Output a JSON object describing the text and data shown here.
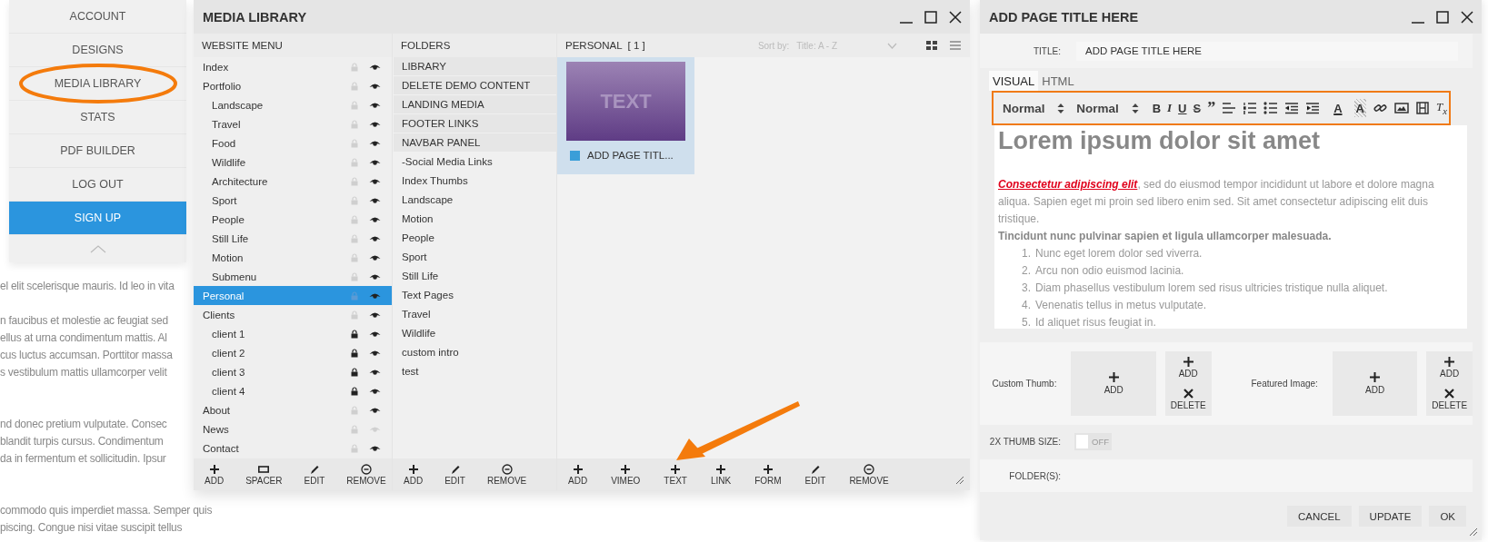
{
  "background_text": [
    [
      "el elit scelerisque mauris. Id leo in vita"
    ],
    [
      "n faucibus et molestie ac feugiat sed",
      "ellus at urna condimentum mattis. Al",
      "cus luctus accumsan. Porttitor massa",
      "s vestibulum mattis ullamcorper velit"
    ],
    [
      "nd donec pretium vulputate. Consec",
      "blandit turpis cursus. Condimentum",
      "da in fermentum et sollicitudin. Ipsur"
    ],
    [
      "commodo quis imperdiet massa. Semper quis",
      "piscing. Congue nisi vitae suscipit tellus"
    ]
  ],
  "account_menu": {
    "items": [
      {
        "label": "ACCOUNT",
        "kind": "item",
        "circled": false
      },
      {
        "label": "DESIGNS",
        "kind": "item",
        "circled": false
      },
      {
        "label": "MEDIA LIBRARY",
        "kind": "item",
        "circled": true
      },
      {
        "label": "STATS",
        "kind": "item",
        "circled": false
      },
      {
        "label": "PDF BUILDER",
        "kind": "item",
        "circled": false
      },
      {
        "label": "LOG OUT",
        "kind": "item",
        "circled": false
      },
      {
        "label": "SIGN UP",
        "kind": "cta",
        "circled": false
      }
    ]
  },
  "media_library": {
    "title": "MEDIA LIBRARY",
    "website_menu": {
      "heading": "WEBSITE MENU",
      "items": [
        {
          "label": "Index",
          "selected": false,
          "locked": false,
          "visible": true
        },
        {
          "label": "Portfolio",
          "selected": false,
          "locked": false,
          "visible": true,
          "children": [
            {
              "label": "Landscape",
              "selected": false,
              "locked": false,
              "visible": true
            },
            {
              "label": "Travel",
              "selected": false,
              "locked": false,
              "visible": true
            },
            {
              "label": "Food",
              "selected": false,
              "locked": false,
              "visible": true
            },
            {
              "label": "Wildlife",
              "selected": false,
              "locked": false,
              "visible": true
            },
            {
              "label": "Architecture",
              "selected": false,
              "locked": false,
              "visible": true
            },
            {
              "label": "Sport",
              "selected": false,
              "locked": false,
              "visible": true
            },
            {
              "label": "People",
              "selected": false,
              "locked": false,
              "visible": true
            },
            {
              "label": "Still Life",
              "selected": false,
              "locked": false,
              "visible": true
            },
            {
              "label": "Motion",
              "selected": false,
              "locked": false,
              "visible": true
            },
            {
              "label": "Submenu",
              "selected": false,
              "locked": false,
              "visible": true
            }
          ]
        },
        {
          "label": "Personal",
          "selected": true,
          "locked": false,
          "visible": true
        },
        {
          "label": "Clients",
          "selected": false,
          "locked": false,
          "visible": true,
          "children": [
            {
              "label": "client 1",
              "selected": false,
              "locked": true,
              "visible": true
            },
            {
              "label": "client 2",
              "selected": false,
              "locked": true,
              "visible": true
            },
            {
              "label": "client 3",
              "selected": false,
              "locked": true,
              "visible": true
            },
            {
              "label": "client 4",
              "selected": false,
              "locked": true,
              "visible": true
            }
          ]
        },
        {
          "label": "About",
          "selected": false,
          "locked": false,
          "visible": true
        },
        {
          "label": "News",
          "selected": false,
          "locked": false,
          "visible": false
        },
        {
          "label": "Contact",
          "selected": false,
          "locked": false,
          "visible": true
        }
      ],
      "toolbar": [
        {
          "kind": "plus",
          "label": "ADD"
        },
        {
          "kind": "spacer",
          "label": "SPACER"
        },
        {
          "kind": "pencil",
          "label": "EDIT"
        },
        {
          "kind": "minus-circle",
          "label": "REMOVE"
        }
      ]
    },
    "folders": {
      "heading": "FOLDERS",
      "items": [
        {
          "label": "LIBRARY",
          "kind": "system"
        },
        {
          "label": "DELETE DEMO CONTENT",
          "kind": "system"
        },
        {
          "label": "LANDING MEDIA",
          "kind": "system"
        },
        {
          "label": "FOOTER LINKS",
          "kind": "system"
        },
        {
          "label": "NAVBAR PANEL",
          "kind": "system"
        },
        {
          "label": "-Social Media Links",
          "kind": "folder"
        },
        {
          "label": "Index Thumbs",
          "kind": "folder"
        },
        {
          "label": "Landscape",
          "kind": "folder"
        },
        {
          "label": "Motion",
          "kind": "folder"
        },
        {
          "label": "People",
          "kind": "folder"
        },
        {
          "label": "Sport",
          "kind": "folder"
        },
        {
          "label": "Still Life",
          "kind": "folder"
        },
        {
          "label": "Text Pages",
          "kind": "folder"
        },
        {
          "label": "Travel",
          "kind": "folder"
        },
        {
          "label": "Wildlife",
          "kind": "folder"
        },
        {
          "label": "custom intro",
          "kind": "folder"
        },
        {
          "label": "test",
          "kind": "folder"
        }
      ],
      "toolbar": [
        {
          "kind": "plus",
          "label": "ADD"
        },
        {
          "kind": "pencil",
          "label": "EDIT"
        },
        {
          "kind": "minus-circle",
          "label": "REMOVE"
        }
      ]
    },
    "content": {
      "heading": "PERSONAL  [ 1 ]",
      "sort_label": "Sort by:",
      "sort_value": "Title: A - Z",
      "items": [
        {
          "thumb_text": "TEXT",
          "title": "ADD PAGE TITL...",
          "selected": true
        }
      ],
      "toolbar": [
        {
          "kind": "plus",
          "label": "ADD",
          "pointed": false
        },
        {
          "kind": "plus",
          "label": "VIMEO",
          "pointed": false
        },
        {
          "kind": "plus",
          "label": "TEXT",
          "pointed": true
        },
        {
          "kind": "plus",
          "label": "LINK",
          "pointed": false
        },
        {
          "kind": "plus",
          "label": "FORM",
          "pointed": false
        },
        {
          "kind": "pencil",
          "label": "EDIT",
          "pointed": false
        },
        {
          "kind": "minus-circle",
          "label": "REMOVE",
          "pointed": false
        }
      ]
    }
  },
  "editor": {
    "title": "ADD PAGE TITLE HERE",
    "title_field": {
      "label": "TITLE:",
      "value": "ADD PAGE TITLE HERE"
    },
    "tabs": [
      {
        "label": "VISUAL",
        "selected": true
      },
      {
        "label": "HTML",
        "selected": false
      }
    ],
    "toolbar": {
      "outlined": true,
      "selects": [
        "Normal",
        "Normal"
      ],
      "tools": [
        {
          "kind": "bold",
          "label": "B"
        },
        {
          "kind": "italic",
          "label": "I"
        },
        {
          "kind": "underline",
          "label": "U"
        },
        {
          "kind": "strike",
          "label": "S"
        },
        {
          "kind": "quote",
          "label": "”"
        },
        {
          "kind": "align"
        },
        {
          "kind": "ordered-list"
        },
        {
          "kind": "bullet-list"
        },
        {
          "kind": "outdent"
        },
        {
          "kind": "indent"
        },
        {
          "kind": "font-color",
          "label": "A"
        },
        {
          "kind": "background-color",
          "label": "A"
        },
        {
          "kind": "link"
        },
        {
          "kind": "image"
        },
        {
          "kind": "video"
        },
        {
          "kind": "clean",
          "label": "T$_{x}$"
        }
      ]
    },
    "content": {
      "heading": "Lorem ipsum dolor sit amet",
      "paragraph": {
        "link": "Consectetur adipiscing elit",
        "text": ", sed do eiusmod tempor incididunt ut labore et dolore magna aliqua. Sapien eget mi proin sed libero enim sed. Sit amet consectetur adipiscing elit duis tristique."
      },
      "bold_line": "Tincidunt nunc pulvinar sapien et ligula ullamcorper malesuada.",
      "list": [
        {
          "number": "1.",
          "text": "Nunc eget lorem dolor sed viverra."
        },
        {
          "number": "2.",
          "text": "Arcu non odio euismod lacinia."
        },
        {
          "number": "3.",
          "text": "Diam phasellus vestibulum lorem sed risus ultricies tristique nulla aliquet."
        },
        {
          "number": "4.",
          "text": "Venenatis tellus in metus vulputate."
        },
        {
          "number": "5.",
          "text": "Id aliquet risus feugiat in."
        }
      ]
    },
    "images": [
      {
        "label": "Custom Thumb:",
        "add": "ADD",
        "side_add": "ADD",
        "side_delete": "DELETE"
      },
      {
        "label": "Featured Image:",
        "add": "ADD",
        "side_add": "ADD",
        "side_delete": "DELETE"
      }
    ],
    "thumb_size": {
      "label": "2X THUMB SIZE:",
      "on": false,
      "state_text": "OFF"
    },
    "folders_label": "FOLDER(S):",
    "buttons": [
      "CANCEL",
      "UPDATE",
      "OK"
    ]
  }
}
